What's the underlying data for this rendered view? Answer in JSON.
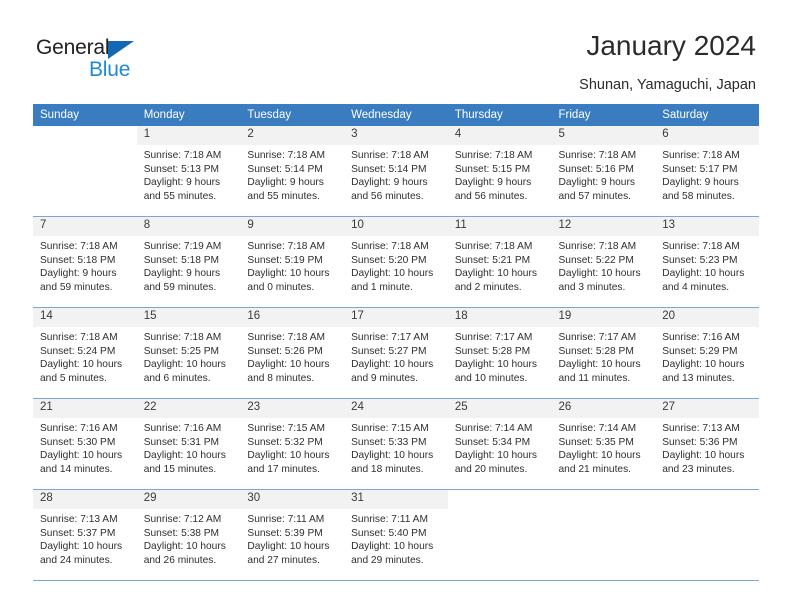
{
  "brand": {
    "name_part1": "General",
    "name_part2": "Blue",
    "accent_color": "#1268b3",
    "accent_color_light": "#1e8bd4"
  },
  "header": {
    "title": "January 2024",
    "subtitle": "Shunan, Yamaguchi, Japan"
  },
  "theme": {
    "header_row_bg": "#3a7cc0",
    "daynum_bg": "#f2f2f2",
    "row_separator": "#7ba7d4"
  },
  "weekdays": [
    "Sunday",
    "Monday",
    "Tuesday",
    "Wednesday",
    "Thursday",
    "Friday",
    "Saturday"
  ],
  "weeks": [
    [
      {
        "day": "",
        "sunrise": "",
        "sunset": "",
        "daylight1": "",
        "daylight2": ""
      },
      {
        "day": "1",
        "sunrise": "Sunrise: 7:18 AM",
        "sunset": "Sunset: 5:13 PM",
        "daylight1": "Daylight: 9 hours",
        "daylight2": "and 55 minutes."
      },
      {
        "day": "2",
        "sunrise": "Sunrise: 7:18 AM",
        "sunset": "Sunset: 5:14 PM",
        "daylight1": "Daylight: 9 hours",
        "daylight2": "and 55 minutes."
      },
      {
        "day": "3",
        "sunrise": "Sunrise: 7:18 AM",
        "sunset": "Sunset: 5:14 PM",
        "daylight1": "Daylight: 9 hours",
        "daylight2": "and 56 minutes."
      },
      {
        "day": "4",
        "sunrise": "Sunrise: 7:18 AM",
        "sunset": "Sunset: 5:15 PM",
        "daylight1": "Daylight: 9 hours",
        "daylight2": "and 56 minutes."
      },
      {
        "day": "5",
        "sunrise": "Sunrise: 7:18 AM",
        "sunset": "Sunset: 5:16 PM",
        "daylight1": "Daylight: 9 hours",
        "daylight2": "and 57 minutes."
      },
      {
        "day": "6",
        "sunrise": "Sunrise: 7:18 AM",
        "sunset": "Sunset: 5:17 PM",
        "daylight1": "Daylight: 9 hours",
        "daylight2": "and 58 minutes."
      }
    ],
    [
      {
        "day": "7",
        "sunrise": "Sunrise: 7:18 AM",
        "sunset": "Sunset: 5:18 PM",
        "daylight1": "Daylight: 9 hours",
        "daylight2": "and 59 minutes."
      },
      {
        "day": "8",
        "sunrise": "Sunrise: 7:19 AM",
        "sunset": "Sunset: 5:18 PM",
        "daylight1": "Daylight: 9 hours",
        "daylight2": "and 59 minutes."
      },
      {
        "day": "9",
        "sunrise": "Sunrise: 7:18 AM",
        "sunset": "Sunset: 5:19 PM",
        "daylight1": "Daylight: 10 hours",
        "daylight2": "and 0 minutes."
      },
      {
        "day": "10",
        "sunrise": "Sunrise: 7:18 AM",
        "sunset": "Sunset: 5:20 PM",
        "daylight1": "Daylight: 10 hours",
        "daylight2": "and 1 minute."
      },
      {
        "day": "11",
        "sunrise": "Sunrise: 7:18 AM",
        "sunset": "Sunset: 5:21 PM",
        "daylight1": "Daylight: 10 hours",
        "daylight2": "and 2 minutes."
      },
      {
        "day": "12",
        "sunrise": "Sunrise: 7:18 AM",
        "sunset": "Sunset: 5:22 PM",
        "daylight1": "Daylight: 10 hours",
        "daylight2": "and 3 minutes."
      },
      {
        "day": "13",
        "sunrise": "Sunrise: 7:18 AM",
        "sunset": "Sunset: 5:23 PM",
        "daylight1": "Daylight: 10 hours",
        "daylight2": "and 4 minutes."
      }
    ],
    [
      {
        "day": "14",
        "sunrise": "Sunrise: 7:18 AM",
        "sunset": "Sunset: 5:24 PM",
        "daylight1": "Daylight: 10 hours",
        "daylight2": "and 5 minutes."
      },
      {
        "day": "15",
        "sunrise": "Sunrise: 7:18 AM",
        "sunset": "Sunset: 5:25 PM",
        "daylight1": "Daylight: 10 hours",
        "daylight2": "and 6 minutes."
      },
      {
        "day": "16",
        "sunrise": "Sunrise: 7:18 AM",
        "sunset": "Sunset: 5:26 PM",
        "daylight1": "Daylight: 10 hours",
        "daylight2": "and 8 minutes."
      },
      {
        "day": "17",
        "sunrise": "Sunrise: 7:17 AM",
        "sunset": "Sunset: 5:27 PM",
        "daylight1": "Daylight: 10 hours",
        "daylight2": "and 9 minutes."
      },
      {
        "day": "18",
        "sunrise": "Sunrise: 7:17 AM",
        "sunset": "Sunset: 5:28 PM",
        "daylight1": "Daylight: 10 hours",
        "daylight2": "and 10 minutes."
      },
      {
        "day": "19",
        "sunrise": "Sunrise: 7:17 AM",
        "sunset": "Sunset: 5:28 PM",
        "daylight1": "Daylight: 10 hours",
        "daylight2": "and 11 minutes."
      },
      {
        "day": "20",
        "sunrise": "Sunrise: 7:16 AM",
        "sunset": "Sunset: 5:29 PM",
        "daylight1": "Daylight: 10 hours",
        "daylight2": "and 13 minutes."
      }
    ],
    [
      {
        "day": "21",
        "sunrise": "Sunrise: 7:16 AM",
        "sunset": "Sunset: 5:30 PM",
        "daylight1": "Daylight: 10 hours",
        "daylight2": "and 14 minutes."
      },
      {
        "day": "22",
        "sunrise": "Sunrise: 7:16 AM",
        "sunset": "Sunset: 5:31 PM",
        "daylight1": "Daylight: 10 hours",
        "daylight2": "and 15 minutes."
      },
      {
        "day": "23",
        "sunrise": "Sunrise: 7:15 AM",
        "sunset": "Sunset: 5:32 PM",
        "daylight1": "Daylight: 10 hours",
        "daylight2": "and 17 minutes."
      },
      {
        "day": "24",
        "sunrise": "Sunrise: 7:15 AM",
        "sunset": "Sunset: 5:33 PM",
        "daylight1": "Daylight: 10 hours",
        "daylight2": "and 18 minutes."
      },
      {
        "day": "25",
        "sunrise": "Sunrise: 7:14 AM",
        "sunset": "Sunset: 5:34 PM",
        "daylight1": "Daylight: 10 hours",
        "daylight2": "and 20 minutes."
      },
      {
        "day": "26",
        "sunrise": "Sunrise: 7:14 AM",
        "sunset": "Sunset: 5:35 PM",
        "daylight1": "Daylight: 10 hours",
        "daylight2": "and 21 minutes."
      },
      {
        "day": "27",
        "sunrise": "Sunrise: 7:13 AM",
        "sunset": "Sunset: 5:36 PM",
        "daylight1": "Daylight: 10 hours",
        "daylight2": "and 23 minutes."
      }
    ],
    [
      {
        "day": "28",
        "sunrise": "Sunrise: 7:13 AM",
        "sunset": "Sunset: 5:37 PM",
        "daylight1": "Daylight: 10 hours",
        "daylight2": "and 24 minutes."
      },
      {
        "day": "29",
        "sunrise": "Sunrise: 7:12 AM",
        "sunset": "Sunset: 5:38 PM",
        "daylight1": "Daylight: 10 hours",
        "daylight2": "and 26 minutes."
      },
      {
        "day": "30",
        "sunrise": "Sunrise: 7:11 AM",
        "sunset": "Sunset: 5:39 PM",
        "daylight1": "Daylight: 10 hours",
        "daylight2": "and 27 minutes."
      },
      {
        "day": "31",
        "sunrise": "Sunrise: 7:11 AM",
        "sunset": "Sunset: 5:40 PM",
        "daylight1": "Daylight: 10 hours",
        "daylight2": "and 29 minutes."
      },
      {
        "day": "",
        "sunrise": "",
        "sunset": "",
        "daylight1": "",
        "daylight2": ""
      },
      {
        "day": "",
        "sunrise": "",
        "sunset": "",
        "daylight1": "",
        "daylight2": ""
      },
      {
        "day": "",
        "sunrise": "",
        "sunset": "",
        "daylight1": "",
        "daylight2": ""
      }
    ]
  ]
}
